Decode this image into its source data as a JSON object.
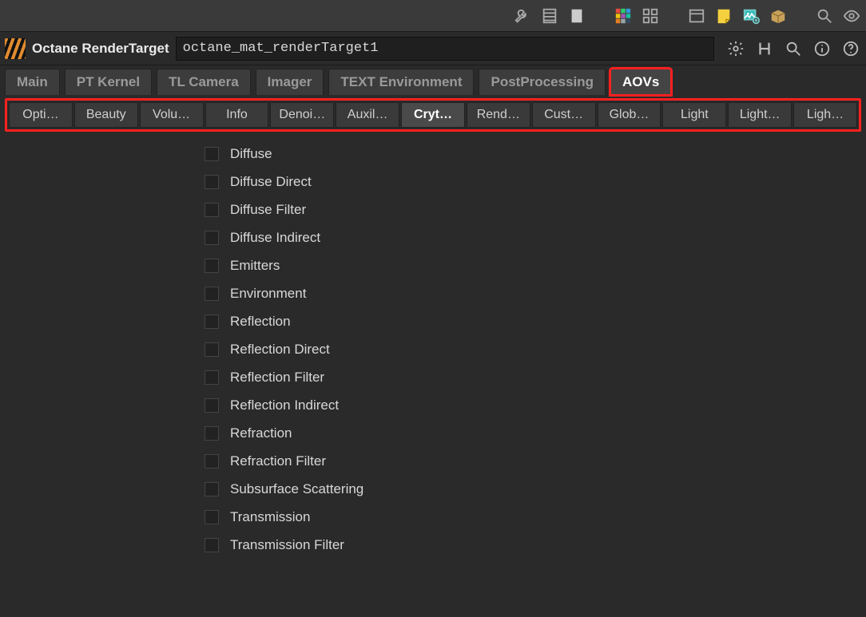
{
  "header": {
    "title": "Octane RenderTarget",
    "path": "octane_mat_renderTarget1"
  },
  "mainTabs": [
    {
      "label": "Main",
      "active": false
    },
    {
      "label": "PT Kernel",
      "active": false
    },
    {
      "label": "TL Camera",
      "active": false
    },
    {
      "label": "Imager",
      "active": false
    },
    {
      "label": "TEXT Environment",
      "active": false
    },
    {
      "label": "PostProcessing",
      "active": false
    },
    {
      "label": "AOVs",
      "active": true,
      "highlight": true
    }
  ],
  "subTabs": [
    {
      "label": "Opti…"
    },
    {
      "label": "Beauty"
    },
    {
      "label": "Volu…"
    },
    {
      "label": "Info"
    },
    {
      "label": "Denoi…"
    },
    {
      "label": "Auxil…"
    },
    {
      "label": "Cryt…",
      "selected": true
    },
    {
      "label": "Rend…"
    },
    {
      "label": "Cust…"
    },
    {
      "label": "Glob…"
    },
    {
      "label": "Light"
    },
    {
      "label": "Light…"
    },
    {
      "label": "Ligh…"
    }
  ],
  "aovs": [
    {
      "label": "Diffuse",
      "checked": false
    },
    {
      "label": "Diffuse Direct",
      "checked": false
    },
    {
      "label": "Diffuse Filter",
      "checked": false
    },
    {
      "label": "Diffuse Indirect",
      "checked": false
    },
    {
      "label": "Emitters",
      "checked": false
    },
    {
      "label": "Environment",
      "checked": false
    },
    {
      "label": "Reflection",
      "checked": false
    },
    {
      "label": "Reflection Direct",
      "checked": false
    },
    {
      "label": "Reflection Filter",
      "checked": false
    },
    {
      "label": "Reflection Indirect",
      "checked": false
    },
    {
      "label": "Refraction",
      "checked": false
    },
    {
      "label": "Refraction Filter",
      "checked": false
    },
    {
      "label": "Subsurface Scattering",
      "checked": false
    },
    {
      "label": "Transmission",
      "checked": false
    },
    {
      "label": "Transmission Filter",
      "checked": false
    }
  ]
}
